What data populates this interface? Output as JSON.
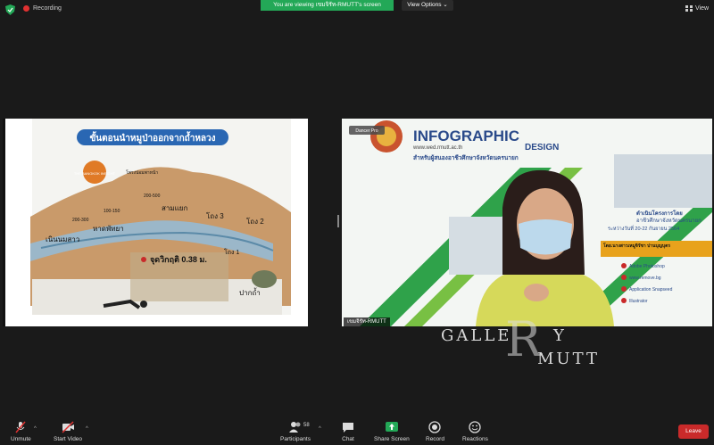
{
  "topbar": {
    "recording_label": "Recording",
    "viewing_banner": "You are viewing เขมจิรัท-RMUTT's screen",
    "view_options": "View Options",
    "view_button": "View"
  },
  "slide": {
    "title": "ขั้นตอนนำหมูป่าออกจากถ้ำหลวง",
    "logo": "THE BANGKOK INSIGHT",
    "labels": {
      "pattaya": "หาดพัทยา",
      "sam_yaek": "สามแยก",
      "noen_nom": "เนินนมสาว",
      "chamber3": "โถง 3",
      "chamber2": "โถง 2",
      "chamber1": "โถง 1",
      "cave_mouth": "ปากถ้ำ",
      "critical": "จุดวิกฤติ 0.38 ม.",
      "pump": "โพรงปอมพาหน้า",
      "d1": "200-300",
      "d2": "100-150",
      "d3": "200-500"
    }
  },
  "camera": {
    "badge": "Dancer Pro",
    "headline": "INFOGRAPHIC",
    "design": "DESIGN",
    "website": "www.wed.rmutt.ac.th",
    "sub1": "สำหรับผู้สนองอาชีวศึกษาจังหวัดนครนายก",
    "org": "ดำเนินโครงการโดย",
    "org2": "อาชีวศึกษาจังหวัดนครนายก",
    "dates": "ระหว่างวันที่ 20-22 กันยายน 2564",
    "lecturer": "โดย.นางสาวเหมูจิรัชา ปานบุญบุตร",
    "items": [
      "Adobe Photoshop",
      "www.remove.bg",
      "Application Snapseed",
      "Illustrator"
    ],
    "participant_name": "เขมจิรัท-RMUTT"
  },
  "watermark": {
    "line1": "GALLE",
    "line1b": "Y",
    "r": "R",
    "line2": "MUTT"
  },
  "toolbar": {
    "unmute": "Unmute",
    "start_video": "Start Video",
    "participants": "Participants",
    "participants_count": "58",
    "chat": "Chat",
    "share_screen": "Share Screen",
    "record": "Record",
    "reactions": "Reactions",
    "leave": "Leave"
  },
  "colors": {
    "share_green": "#23a857",
    "leave_red": "#c92a2a",
    "slide_blue": "#2a67b3"
  }
}
